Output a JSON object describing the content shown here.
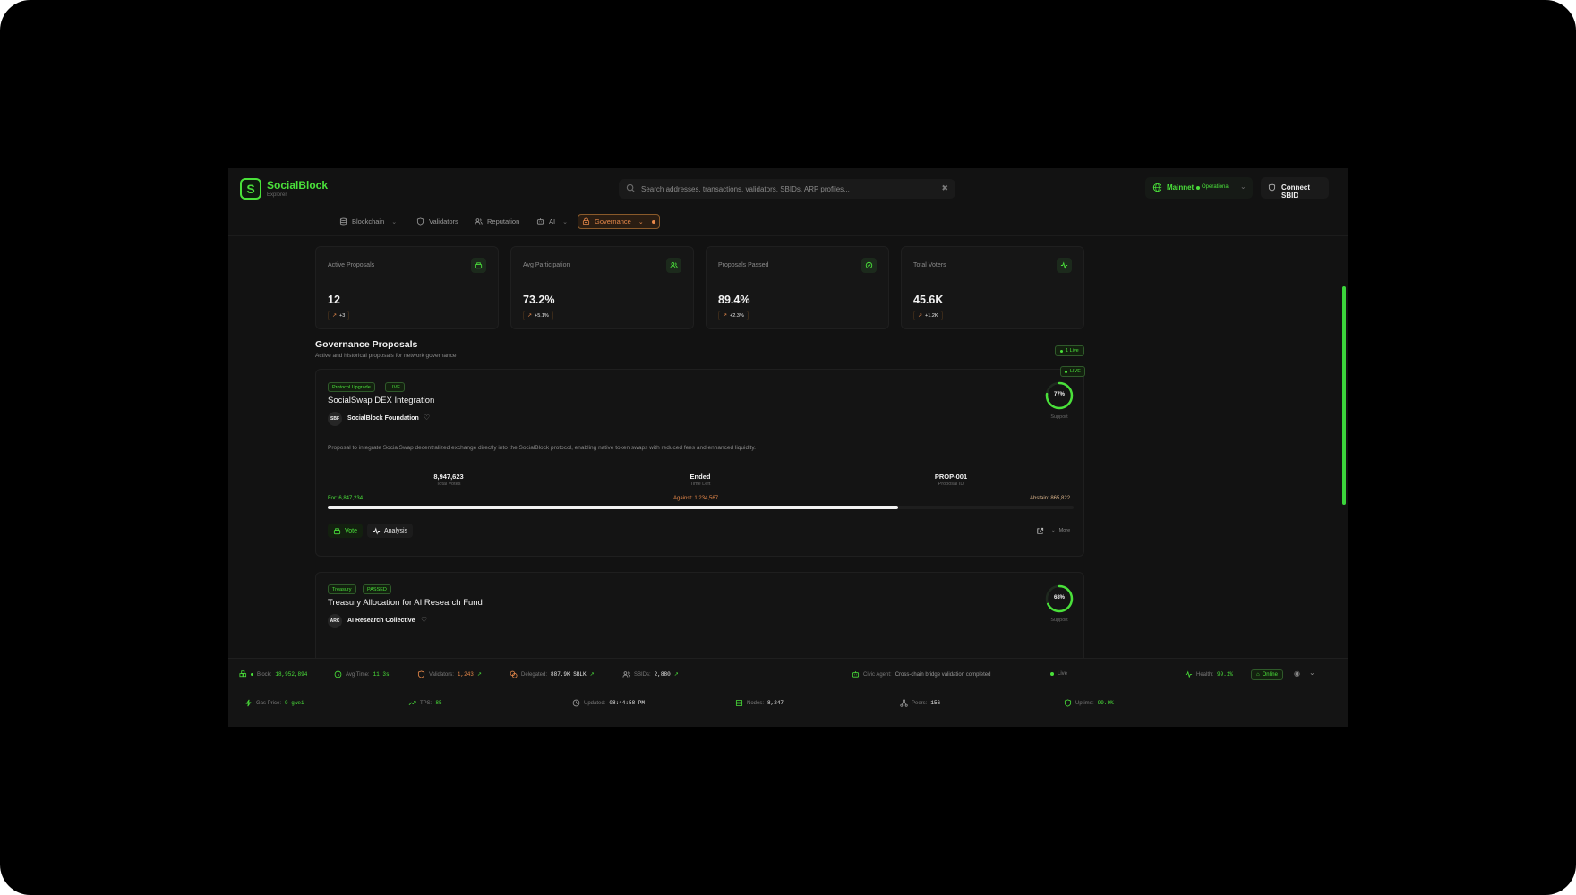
{
  "app": {
    "name": "SocialBlock",
    "subtitle": "Explorer",
    "logo_glyph": "S",
    "accent": "#4ae03a",
    "highlight": "#e8894a"
  },
  "search": {
    "placeholder": "Search addresses, transactions, validators, SBIDs, ARP profiles..."
  },
  "network": {
    "name": "Mainnet",
    "status": "Operational"
  },
  "connect": {
    "label": "Connect SBID"
  },
  "nav": {
    "items": [
      {
        "label": "Blockchain",
        "icon": "database-icon"
      },
      {
        "label": "Validators",
        "icon": "shield-icon"
      },
      {
        "label": "Reputation",
        "icon": "users-icon"
      },
      {
        "label": "AI",
        "icon": "bot-icon"
      },
      {
        "label": "Governance",
        "icon": "gavel-icon",
        "active": true
      }
    ]
  },
  "stats": [
    {
      "label": "Active Proposals",
      "value": "12",
      "delta": "+3",
      "icon": "ballot-icon"
    },
    {
      "label": "Avg Participation",
      "value": "73.2%",
      "delta": "+5.1%",
      "icon": "users-icon"
    },
    {
      "label": "Proposals Passed",
      "value": "89.4%",
      "delta": "+2.3%",
      "icon": "check-circle-icon"
    },
    {
      "label": "Total Voters",
      "value": "45.6K",
      "delta": "+1.2K",
      "icon": "activity-icon"
    }
  ],
  "governance": {
    "title": "Governance Proposals",
    "subtitle": "Active and historical proposals for network governance",
    "live_count": "1 Live"
  },
  "proposals": [
    {
      "category": "Protocol Upgrade",
      "status": "LIVE",
      "status_badge": "LIVE",
      "title": "SocialSwap DEX Integration",
      "author_initials": "SBF",
      "author": "SocialBlock Foundation",
      "support_pct": 77,
      "support_label": "77%",
      "support_caption": "Support",
      "description": "Proposal to integrate SocialSwap decentralized exchange directly into the SocialBlock protocol, enabling native token swaps with reduced fees and enhanced liquidity.",
      "total_votes": "8,947,623",
      "total_votes_label": "Total Votes",
      "time_left": "Ended",
      "time_left_label": "Time Left",
      "proposal_id": "PROP-001",
      "proposal_id_label": "Proposal ID",
      "for_label": "For: 6,847,234",
      "against_label": "Against: 1,234,567",
      "abstain_label": "Abstain: 865,822",
      "for_fraction": 0.765,
      "vote_label": "Vote",
      "analysis_label": "Analysis",
      "more_label": "More"
    },
    {
      "category": "Treasury",
      "status": "PASSED",
      "title": "Treasury Allocation for AI Research Fund",
      "author_initials": "ARC",
      "author": "AI Research Collective",
      "support_pct": 68,
      "support_label": "68%",
      "support_caption": "Support"
    }
  ],
  "footer": {
    "row1": [
      {
        "label": "Block:",
        "value": "18,952,894",
        "icon": "blocks-icon"
      },
      {
        "label": "Avg Time:",
        "value": "11.3s",
        "icon": "clock-icon"
      },
      {
        "label": "Validators:",
        "value": "1,243",
        "icon": "shield-icon",
        "color": "orange"
      },
      {
        "label": "Delegated:",
        "value": "887.9K SBLK",
        "icon": "coins-icon",
        "color": "white"
      },
      {
        "label": "SBIDs:",
        "value": "2,880",
        "icon": "users-icon",
        "color": "white"
      },
      {
        "label": "Civic Agent:",
        "value": "Cross-chain bridge validation completed",
        "icon": "bot-icon",
        "color": "muted"
      },
      {
        "label": "Live",
        "icon": "dot"
      },
      {
        "label": "Health:",
        "value": "99.1%",
        "icon": "activity-icon"
      }
    ],
    "online": "Online",
    "row2": [
      {
        "label": "Gas Price:",
        "value": "9 gwei",
        "icon": "zap-icon"
      },
      {
        "label": "TPS:",
        "value": "85",
        "icon": "trending-up-icon"
      },
      {
        "label": "Updated:",
        "value": "08:44:58 PM",
        "icon": "clock-icon",
        "color": "white"
      },
      {
        "label": "Nodes:",
        "value": "8,247",
        "icon": "server-icon",
        "color": "white"
      },
      {
        "label": "Peers:",
        "value": "156",
        "icon": "network-icon",
        "color": "white"
      },
      {
        "label": "Uptime:",
        "value": "99.9%",
        "icon": "shield-icon"
      }
    ]
  }
}
